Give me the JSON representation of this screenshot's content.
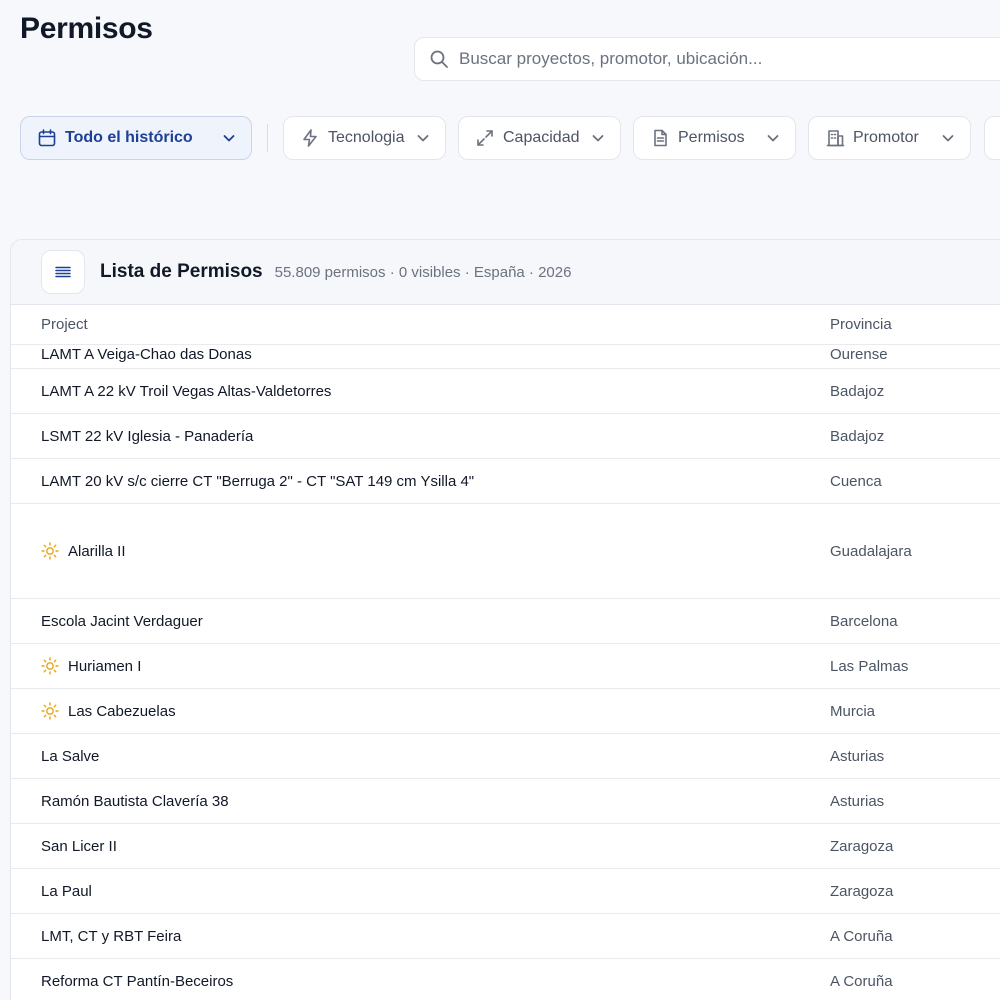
{
  "header": {
    "title": "Permisos",
    "search_placeholder": "Buscar proyectos, promotor, ubicación..."
  },
  "filters": {
    "date": "Todo el histórico",
    "tech": "Tecnologia",
    "capacity": "Capacidad",
    "permits": "Permisos",
    "promoter": "Promotor"
  },
  "panel": {
    "title": "Lista de Permisos",
    "subtitle": "55.809 permisos · 0 visibles · España · 2026"
  },
  "table": {
    "columns": {
      "project": "Project",
      "provincia": "Provincia"
    },
    "rows": [
      {
        "project": "LAMT A Veiga-Chao das Donas",
        "provincia": "Ourense",
        "icon": ""
      },
      {
        "project": "LAMT A 22 kV Troil Vegas Altas-Valdetorres",
        "provincia": "Badajoz",
        "icon": ""
      },
      {
        "project": "LSMT 22 kV Iglesia - Panadería",
        "provincia": "Badajoz",
        "icon": ""
      },
      {
        "project": "LAMT 20 kV s/c cierre CT \"Berruga 2\" - CT \"SAT 149 cm Ysilla 4\"",
        "provincia": "Cuenca",
        "icon": ""
      },
      {
        "project": "Alarilla II",
        "provincia": "Guadalajara",
        "icon": "sun-icon"
      },
      {
        "project": "Escola Jacint Verdaguer",
        "provincia": "Barcelona",
        "icon": ""
      },
      {
        "project": "Huriamen I",
        "provincia": "Las Palmas",
        "icon": "sun-icon"
      },
      {
        "project": "Las Cabezuelas",
        "provincia": "Murcia",
        "icon": "sun-icon"
      },
      {
        "project": "La Salve",
        "provincia": "Asturias",
        "icon": ""
      },
      {
        "project": "Ramón Bautista Clavería 38",
        "provincia": "Asturias",
        "icon": ""
      },
      {
        "project": "San Licer II",
        "provincia": "Zaragoza",
        "icon": ""
      },
      {
        "project": "La Paul",
        "provincia": "Zaragoza",
        "icon": ""
      },
      {
        "project": "LMT, CT y RBT Feira",
        "provincia": "A Coruña",
        "icon": ""
      },
      {
        "project": "Reforma CT Pantín-Beceiros",
        "provincia": "A Coruña",
        "icon": ""
      }
    ]
  },
  "colors": {
    "accent": "#1d3f95",
    "sun": "#e8a317"
  }
}
